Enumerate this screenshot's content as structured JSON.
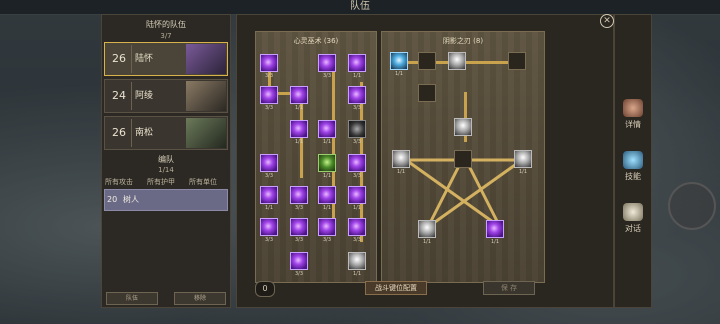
{
  "window_title": "队伍",
  "party": {
    "title": "陆怀的队伍",
    "count": "3/7",
    "members": [
      {
        "level": "26",
        "name": "陆怀",
        "selected": true
      },
      {
        "level": "24",
        "name": "阿绫",
        "selected": false
      },
      {
        "level": "26",
        "name": "南松",
        "selected": false
      }
    ],
    "team_title": "编队",
    "team_count": "1/14",
    "filters": [
      "所有攻击",
      "所有护甲",
      "所有单位"
    ],
    "unit": {
      "level": "20",
      "name": "树人"
    },
    "buttons": [
      "队伍",
      "移除"
    ]
  },
  "trees": {
    "left": {
      "title": "心灵巫术 (36)",
      "counts": [
        "3/3",
        "3/3",
        "1/1",
        "3/3",
        "1/1",
        "3/3",
        "1/1",
        "1/1",
        "3/3",
        "3/3",
        "1/1",
        "3/3",
        "1/1",
        "3/3",
        "1/1",
        "1/1",
        "3/3",
        "3/3",
        "3/3",
        "3/3",
        "3/3",
        "1/1",
        "0/1"
      ]
    },
    "right": {
      "title": "阴影之刃 (8)",
      "counts": [
        "1/1",
        "1/1",
        "1/1",
        "1/1",
        "1/1",
        "1/1"
      ]
    }
  },
  "bottom": {
    "count": "0",
    "keys_button": "战斗键位配置",
    "save_button": "保 存"
  },
  "tabs": [
    {
      "label": "详情",
      "icon": "fist-icon"
    },
    {
      "label": "技能",
      "icon": "book-icon"
    },
    {
      "label": "对话",
      "icon": "speech-icon"
    }
  ],
  "close": "✕"
}
